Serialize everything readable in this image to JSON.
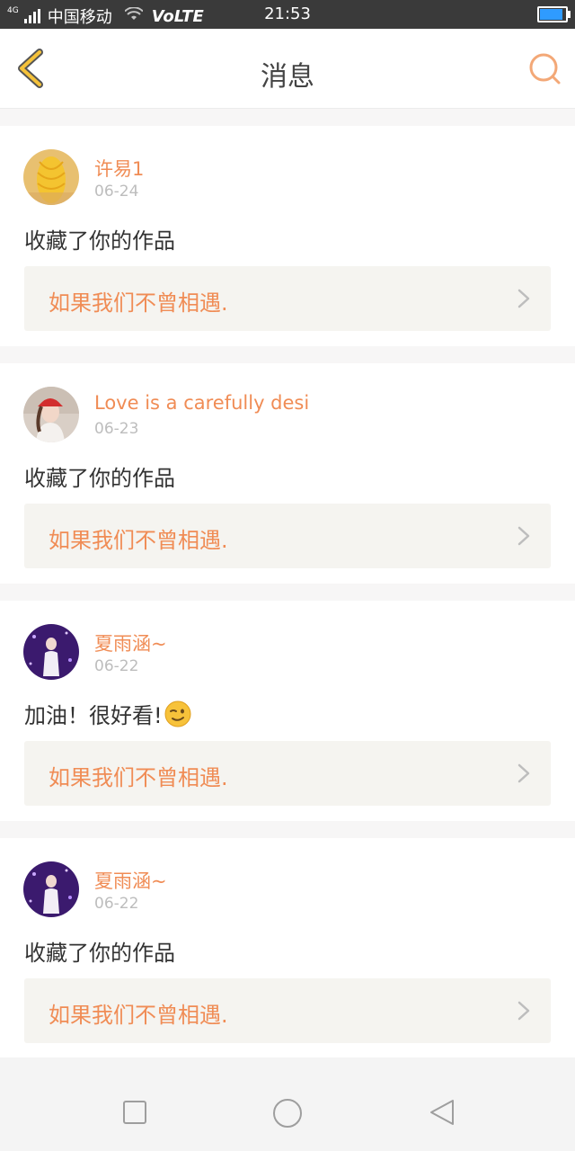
{
  "status_bar": {
    "network": "4G",
    "carrier": "中国移动",
    "volte": "VoLTE",
    "time": "21:53",
    "battery_level": 0.9
  },
  "header": {
    "title": "消息",
    "back_icon": "chevron-left-icon",
    "search_icon": "search-icon"
  },
  "messages": [
    {
      "user": "许易1",
      "date": "06-24",
      "text": "收藏了你的作品",
      "work": "如果我们不曾相遇.",
      "avatar": "corn-photo"
    },
    {
      "user": "Love is a carefully desi",
      "date": "06-23",
      "text": "收藏了你的作品",
      "work": "如果我们不曾相遇.",
      "avatar": "girl-red-cap-photo"
    },
    {
      "user": "夏雨涵~",
      "date": "06-22",
      "text": "加油！很好看!",
      "emoji": "winking-face-emoji",
      "work": "如果我们不曾相遇.",
      "avatar": "purple-stage-photo"
    },
    {
      "user": "夏雨涵~",
      "date": "06-22",
      "text": "收藏了你的作品",
      "work": "如果我们不曾相遇.",
      "avatar": "purple-stage-photo"
    }
  ],
  "colors": {
    "accent": "#f08c55",
    "back_icon": "#f5c23a",
    "link_bg": "#f5f4f0",
    "page_bg": "#f7f6f6"
  },
  "nav_bar": {
    "recents_icon": "square-icon",
    "home_icon": "circle-icon",
    "back_icon": "triangle-back-icon"
  }
}
